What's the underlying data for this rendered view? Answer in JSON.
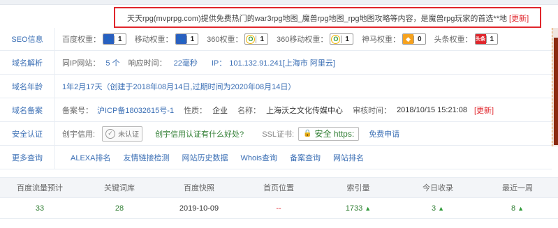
{
  "description": {
    "text": "天天rpg(mvprpg.com)提供免费热门的war3rpg地图_魔兽rpg地图_rpg地图攻略等内容，是魔兽rpg玩家的首选**地",
    "update_label": "[更新]"
  },
  "seo": {
    "title": "SEO信息",
    "items": [
      {
        "label": "百度权重：",
        "icon": "paw-icon",
        "value": "1"
      },
      {
        "label": "移动权重：",
        "icon": "paw-icon",
        "value": "1"
      },
      {
        "label": "360权重：",
        "icon": "360-icon",
        "value": "1"
      },
      {
        "label": "360移动权重：",
        "icon": "360-icon",
        "value": "1"
      },
      {
        "label": "神马权重：",
        "icon": "shenma-icon",
        "value": "0"
      },
      {
        "label": "头条权重：",
        "icon": "toutiao-icon",
        "icon_text": "头条",
        "value": "1"
      }
    ]
  },
  "dns": {
    "title": "域名解析",
    "same_ip_label": "同IP网站：",
    "same_ip_value": "5 个",
    "response_label": "响应时间：",
    "response_value": "22毫秒",
    "ip_label": "IP：",
    "ip_value": "101.132.91.241[上海市 阿里云]"
  },
  "age": {
    "title": "域名年龄",
    "value": "1年2月17天（创建于2018年08月14日,过期时间为2020年08月14日）"
  },
  "icp": {
    "title": "域名备案",
    "no_label": "备案号：",
    "no_value": "沪ICP备18032615号-1",
    "nature_label": "性质：",
    "nature_value": "企业",
    "name_label": "名称：",
    "name_value": "上海沃之文化传媒中心",
    "time_label": "审核时间：",
    "time_value": "2018/10/15 15:21:08",
    "update_label": "[更新]"
  },
  "security": {
    "title": "安全认证",
    "credit_label": "创宇信用:",
    "cert_text": "未认证",
    "cert_link": "创宇信用认证有什么好处?",
    "ssl_label": "SSL证书:",
    "ssl_text": "安全 https:",
    "ssl_link": "免费申请"
  },
  "more": {
    "title": "更多查询",
    "links": [
      "ALEXA排名",
      "友情链接检测",
      "网站历史数据",
      "Whois查询",
      "备案查询",
      "网站排名"
    ]
  },
  "stats": {
    "headers": [
      "百度流量预计",
      "关键词库",
      "百度快照",
      "首页位置",
      "索引量",
      "今日收录",
      "最近一周"
    ],
    "values": [
      "33",
      "28",
      "2019-10-09",
      "--",
      "1733",
      "3",
      "8"
    ],
    "arrows": [
      false,
      false,
      false,
      false,
      true,
      true,
      true
    ]
  },
  "colors": {
    "link_blue": "#3b6fb5",
    "highlight_red": "#e0262c",
    "green": "#2f7d32"
  }
}
